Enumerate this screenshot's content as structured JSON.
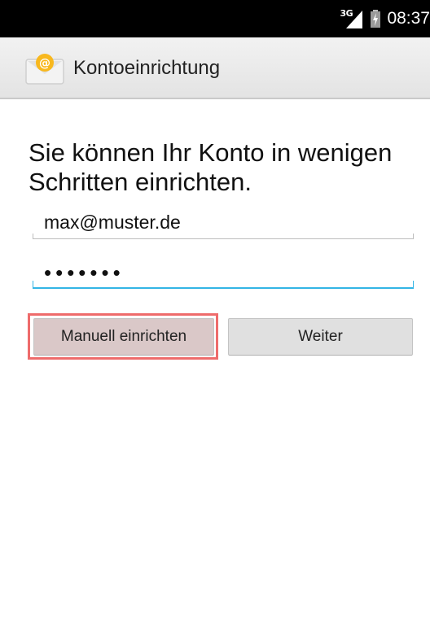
{
  "status_bar": {
    "network_label": "3G",
    "time": "08:37",
    "icons": [
      "signal-icon",
      "battery-icon"
    ]
  },
  "action_bar": {
    "title": "Kontoeinrichtung",
    "icon": "email-app-icon"
  },
  "main": {
    "headline": "Sie können Ihr Konto in wenigen Schritten einrichten.",
    "email_value": "max@muster.de",
    "password_masked": "•••••••",
    "manual_setup_label": "Manuell einrichten",
    "next_label": "Weiter"
  },
  "colors": {
    "focus_underline": "#33b5e5",
    "highlight_frame": "#ee6b6b"
  }
}
